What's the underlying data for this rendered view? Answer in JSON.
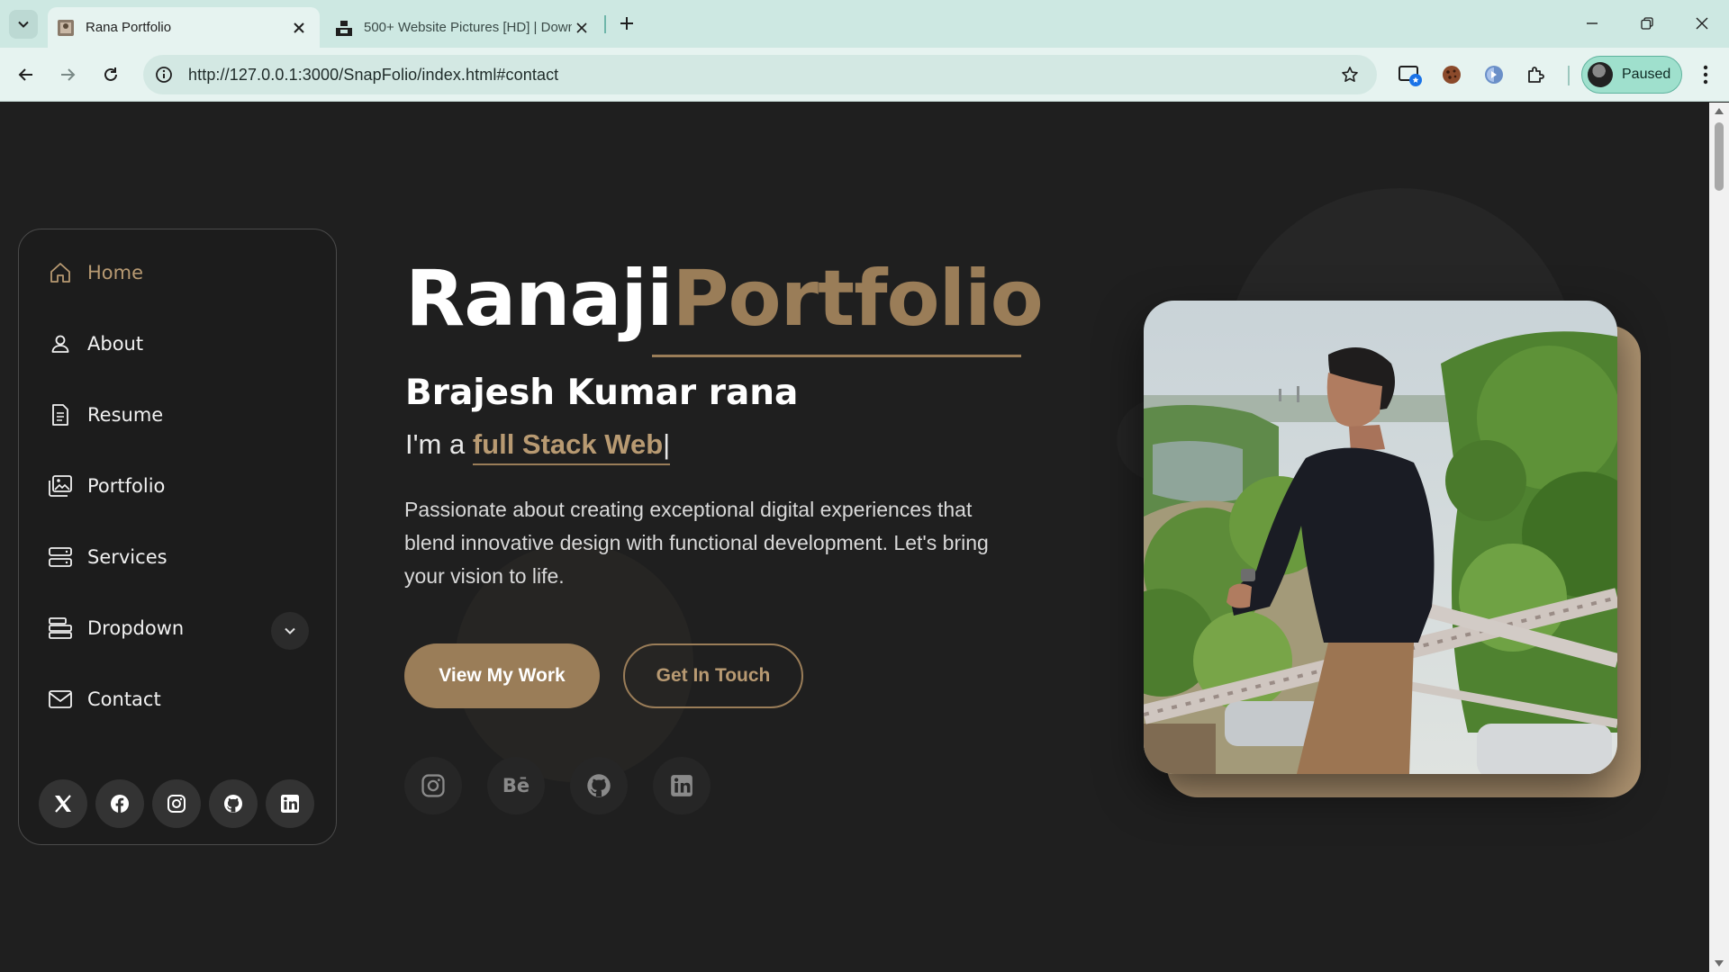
{
  "browser": {
    "tabs": [
      {
        "title": "Rana Portfolio",
        "active": true
      },
      {
        "title": "500+ Website Pictures [HD] | Down",
        "active": false
      }
    ],
    "url": "http://127.0.0.1:3000/SnapFolio/index.html#contact",
    "profile_label": "Paused"
  },
  "sidebar": {
    "items": [
      {
        "label": "Home",
        "icon": "home-icon",
        "active": true
      },
      {
        "label": "About",
        "icon": "person-icon"
      },
      {
        "label": "Resume",
        "icon": "file-text-icon"
      },
      {
        "label": "Portfolio",
        "icon": "images-icon"
      },
      {
        "label": "Services",
        "icon": "hdd-stack-icon"
      },
      {
        "label": "Dropdown",
        "icon": "menu-stack-icon",
        "has_chevron": true
      },
      {
        "label": "Contact",
        "icon": "envelope-icon"
      }
    ],
    "social": [
      "x-twitter-icon",
      "facebook-icon",
      "instagram-icon",
      "github-icon",
      "linkedin-icon"
    ]
  },
  "hero": {
    "title_first": "Ranaji",
    "title_second": "Portfolio",
    "name": "Brajesh Kumar rana",
    "typed_prefix": "I'm a ",
    "typed_text": "full Stack Web",
    "typed_caret": "|",
    "description": "Passionate about creating exceptional digital experiences that blend innovative design with functional development. Let's bring your vision to life.",
    "primary_button": "View My Work",
    "secondary_button": "Get In Touch",
    "social": [
      "instagram-icon",
      "behance-icon",
      "github-icon",
      "linkedin-icon"
    ],
    "behance_glyph": "Bē"
  },
  "colors": {
    "accent": "#9a7d58",
    "accent_light": "#b89a72",
    "background": "#1f1f1f",
    "photo_backer": "#b09572"
  }
}
